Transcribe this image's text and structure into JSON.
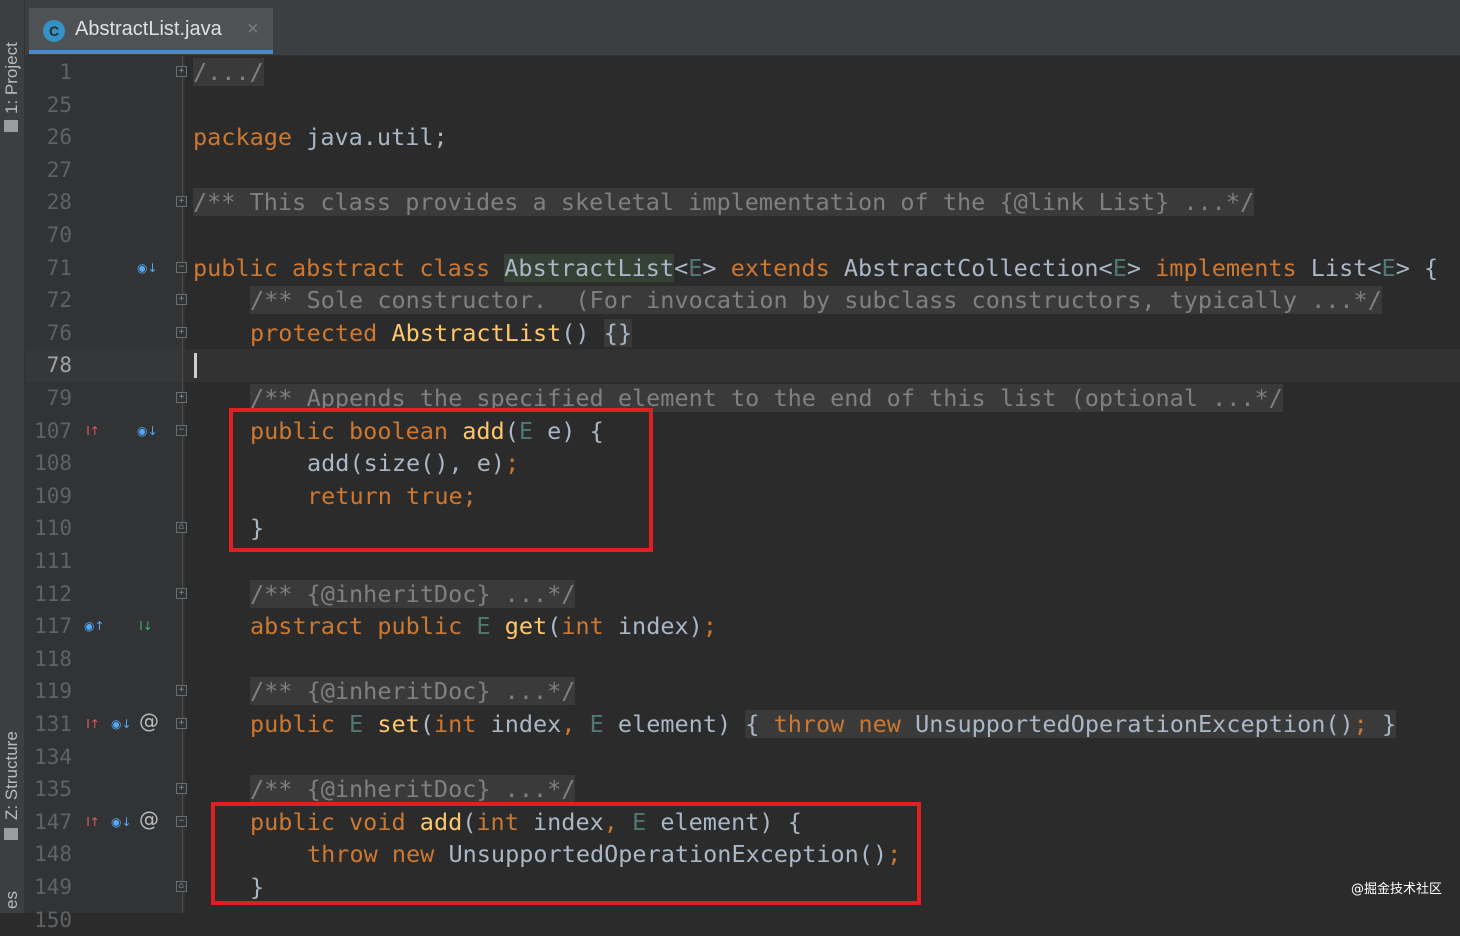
{
  "sidebar": {
    "project_tab": "1: Project",
    "structure_tab": "Z: Structure",
    "bottom_tab_fragment": "es"
  },
  "editor_tab": {
    "title": "AbstractList.java",
    "close_glyph": "×",
    "icon_letter": "C"
  },
  "editor": {
    "lines": [
      {
        "number": "1",
        "fold": "plus",
        "icons": []
      },
      {
        "number": "25",
        "fold": "",
        "icons": []
      },
      {
        "number": "26",
        "fold": "",
        "icons": []
      },
      {
        "number": "27",
        "fold": "",
        "icons": []
      },
      {
        "number": "28",
        "fold": "plus",
        "icons": []
      },
      {
        "number": "70",
        "fold": "",
        "icons": []
      },
      {
        "number": "71",
        "fold": "minus",
        "icons": [
          "overridden-icon"
        ]
      },
      {
        "number": "72",
        "fold": "plus",
        "icons": []
      },
      {
        "number": "76",
        "fold": "plus",
        "icons": []
      },
      {
        "number": "78",
        "fold": "",
        "icons": [],
        "current": true
      },
      {
        "number": "79",
        "fold": "plus",
        "icons": []
      },
      {
        "number": "107",
        "fold": "minus",
        "icons": [
          "implements-up-icon",
          "overridden-icon"
        ]
      },
      {
        "number": "108",
        "fold": "",
        "icons": []
      },
      {
        "number": "109",
        "fold": "",
        "icons": []
      },
      {
        "number": "110",
        "fold": "end",
        "icons": []
      },
      {
        "number": "111",
        "fold": "",
        "icons": []
      },
      {
        "number": "112",
        "fold": "plus",
        "icons": []
      },
      {
        "number": "117",
        "fold": "",
        "icons": [
          "overrides-up-icon",
          "implemented-icon"
        ]
      },
      {
        "number": "118",
        "fold": "",
        "icons": []
      },
      {
        "number": "119",
        "fold": "plus",
        "icons": []
      },
      {
        "number": "131",
        "fold": "plus",
        "icons": [
          "implements-up-icon",
          "overridden-icon",
          "annotation-icon"
        ]
      },
      {
        "number": "134",
        "fold": "",
        "icons": []
      },
      {
        "number": "135",
        "fold": "plus",
        "icons": []
      },
      {
        "number": "147",
        "fold": "minus",
        "icons": [
          "implements-up-icon",
          "overridden-icon",
          "annotation-icon"
        ]
      },
      {
        "number": "148",
        "fold": "",
        "icons": []
      },
      {
        "number": "149",
        "fold": "end",
        "icons": []
      },
      {
        "number": "150",
        "fold": "",
        "icons": []
      }
    ],
    "code": {
      "l1": "/.../",
      "l26_kw": "package",
      "l26_rest": " java.util;",
      "l28": "/** This class provides a skeletal implementation of the {@link List} ...*/",
      "l71_kw1": "public abstract class",
      "l71_name": "AbstractList",
      "l71_lt": "<",
      "l71_E1": "E",
      "l71_gt": ">",
      "l71_kw2": "extends",
      "l71_mid": " AbstractCollection<",
      "l71_E2": "E",
      "l71_mid2": "> ",
      "l71_kw3": "implements",
      "l71_end": " List<",
      "l71_E3": "E",
      "l71_end2": "> {",
      "l72": "/** Sole constructor.  (For invocation by subclass constructors, typically ...*/",
      "l76_kw": "protected",
      "l76_fn": "AbstractList",
      "l76_paren": "()",
      "l76_body": "{}",
      "l79": "/** Appends the specified element to the end of this list (optional ...*/",
      "l107_kw": "public boolean",
      "l107_fn": "add",
      "l107_p1": "(",
      "l107_E": "E",
      "l107_p2": " e) {",
      "l108": "add(size(), e)",
      "l108_semi": ";",
      "l109_kw": "return true;",
      "l110": "}",
      "l112": "/** {@inheritDoc} ...*/",
      "l117_kw": "abstract public",
      "l117_E": "E",
      "l117_fn": "get",
      "l117_p1": "(",
      "l117_int": "int",
      "l117_p2": " index)",
      "l117_semi": ";",
      "l119": "/** {@inheritDoc} ...*/",
      "l131_kw": "public",
      "l131_E": "E",
      "l131_fn": "set",
      "l131_p1": "(",
      "l131_int": "int",
      "l131_p2": " index",
      "l131_comma": ",",
      "l131_E2": "E",
      "l131_p3": " element)",
      "l131_b1": "{ ",
      "l131_kw2": "throw new",
      "l131_ex": " UnsupportedOperationException()",
      "l131_semi": ";",
      "l131_b2": " }",
      "l135": "/** {@inheritDoc} ...*/",
      "l147_kw": "public void",
      "l147_fn": "add",
      "l147_p1": "(",
      "l147_int": "int",
      "l147_p2": " index",
      "l147_comma": ",",
      "l147_E": "E",
      "l147_p3": " element) {",
      "l148_kw": "throw new",
      "l148_ex": " UnsupportedOperationException()",
      "l148_semi": ";",
      "l149": "}"
    }
  },
  "annotations": {
    "highlight_color": "#e02020"
  },
  "watermark": "@掘金技术社区"
}
